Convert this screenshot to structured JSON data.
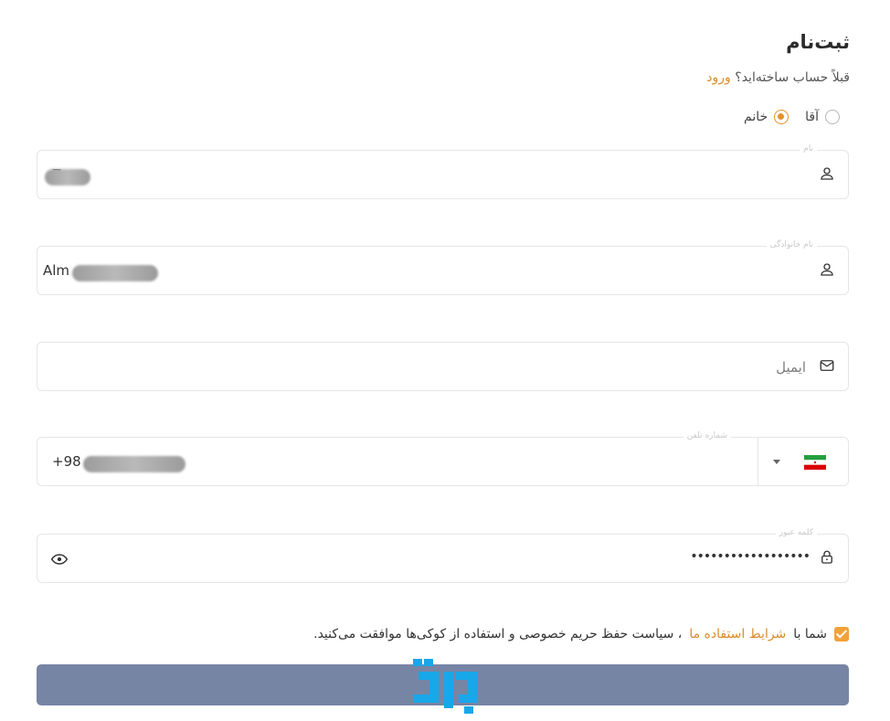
{
  "header": {
    "title": "ثبت‌نام",
    "subtitle_text": "قبلاً حساب ساخته‌اید؟",
    "login_link": "ورود"
  },
  "gender": {
    "options": [
      {
        "label": "آقا",
        "checked": false
      },
      {
        "label": "خانم",
        "checked": true
      }
    ]
  },
  "form": {
    "first_name": {
      "label": "نام",
      "value": "Z",
      "icon": "user-icon"
    },
    "last_name": {
      "label": "نام خانوادگی",
      "value": "Alm",
      "icon": "user-icon"
    },
    "email": {
      "placeholder": "ایمیل",
      "icon": "envelope-icon"
    },
    "phone": {
      "label": "شماره تلفن",
      "value": "+98",
      "country_icon": "iran-flag-icon"
    },
    "password": {
      "label": "کلمه عبور",
      "value": "••••••••••••••••••",
      "icon": "lock-icon"
    }
  },
  "consent": {
    "prefix": "شما با",
    "terms_link": "شرایط استفاده ما",
    "suffix": "، سیاست حفظ حریم خصوصی و استفاده از کوکی‌ها موافقت می‌کنید.",
    "checked": true
  },
  "colors": {
    "accent": "#e4922f",
    "button": "#7785a5",
    "logo": "#18a7e8"
  }
}
